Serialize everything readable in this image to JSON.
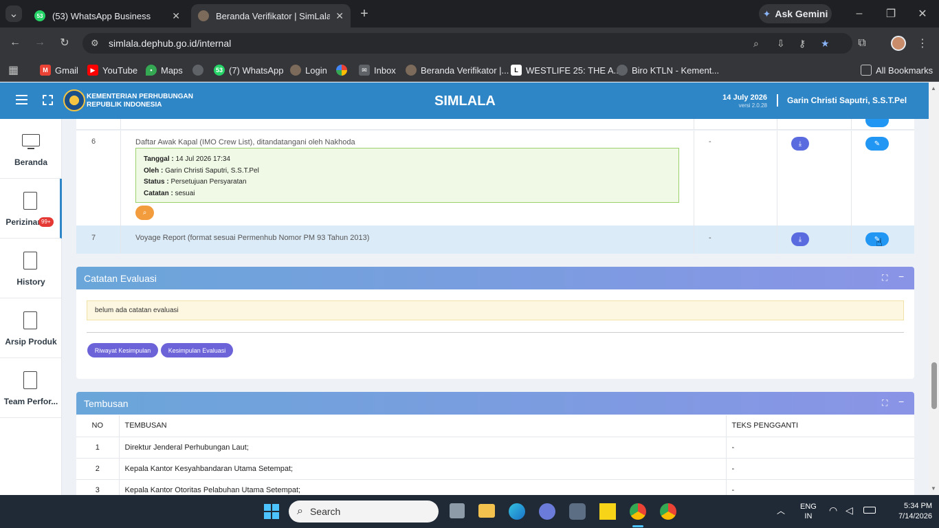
{
  "browser": {
    "tabs": [
      {
        "title": "(53) WhatsApp Business",
        "badge": "53"
      },
      {
        "title": "Beranda Verifikator | SimLala"
      }
    ],
    "ask_gemini": "Ask Gemini",
    "url": "simlala.dephub.go.id/internal",
    "bookmarks": [
      "Gmail",
      "YouTube",
      "Maps",
      "(7) WhatsApp",
      "Login",
      "Inbox",
      "Beranda Verifikator |...",
      "WESTLIFE 25: THE A...",
      "Biro KTLN - Kement..."
    ],
    "all_bookmarks": "All Bookmarks"
  },
  "app": {
    "org_line1": "KEMENTERIAN PERHUBUNGAN",
    "org_line2": "REPUBLIK INDONESIA",
    "title": "SIMLALA",
    "date": "14 July 2026",
    "version": "versi 2.0.28",
    "user": "Garin Christi Saputri, S.S.T.Pel"
  },
  "sidebar": [
    {
      "label": "Beranda",
      "icon": "monitor-icon"
    },
    {
      "label": "Perizinan",
      "icon": "document-icon",
      "badge": "99+"
    },
    {
      "label": "History",
      "icon": "document-icon"
    },
    {
      "label": "Arsip Produk",
      "icon": "document-icon"
    },
    {
      "label": "Team Perfor...",
      "icon": "document-icon"
    }
  ],
  "requirements": [
    {
      "no": "6",
      "name": "Daftar Awak Kapal (IMO Crew List), ditandatangani oleh Nakhoda",
      "col3": "-",
      "note": {
        "tanggal_label": "Tanggal :",
        "tanggal": "14 Jul 2026 17:34",
        "oleh_label": "Oleh :",
        "oleh": "Garin Christi Saputri, S.S.T.Pel",
        "status_label": "Status :",
        "status": "Persetujuan Persyaratan",
        "catatan_label": "Catatan :",
        "catatan": "sesuai"
      }
    },
    {
      "no": "7",
      "name": "Voyage Report (format sesuai Permenhub Nomor PM 93 Tahun 2013)",
      "col3": "-"
    }
  ],
  "evaluasi": {
    "title": "Catatan Evaluasi",
    "empty_text": "belum ada catatan evaluasi",
    "btn_riwayat": "Riwayat Kesimpulan",
    "btn_kesimpulan": "Kesimpulan Evaluasi"
  },
  "tembusan": {
    "title": "Tembusan",
    "columns": [
      "NO",
      "TEMBUSAN",
      "TEKS PENGGANTI"
    ],
    "rows": [
      [
        "1",
        "Direktur Jenderal Perhubungan Laut;",
        "-"
      ],
      [
        "2",
        "Kepala Kantor Kesyahbandaran Utama Setempat;",
        "-"
      ],
      [
        "3",
        "Kepala Kantor Otoritas Pelabuhan Utama Setempat;",
        "-"
      ]
    ]
  },
  "taskbar": {
    "search": "Search",
    "lang1": "ENG",
    "lang2": "IN",
    "time": "5:34 PM",
    "date": "7/14/2026"
  }
}
